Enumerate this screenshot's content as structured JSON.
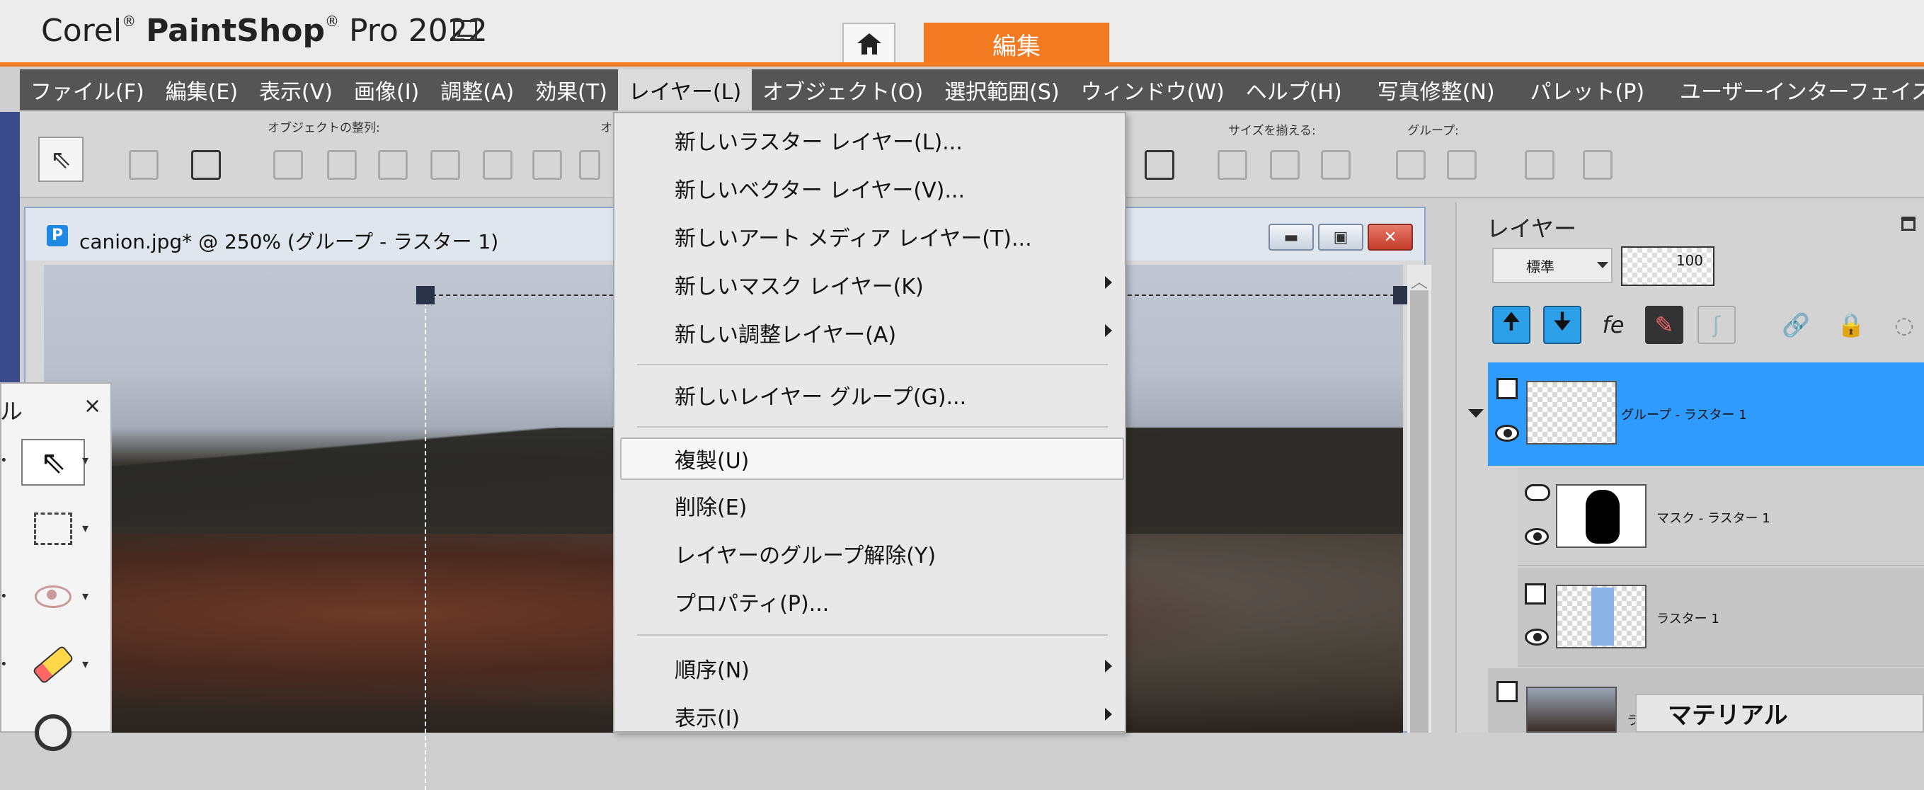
{
  "app": {
    "brand": "Corel",
    "product": "PaintShop",
    "pro": "Pro 2022",
    "home_tab": "home",
    "active_tab": "編集"
  },
  "menubar": {
    "items": [
      "ファイル(F)",
      "編集(E)",
      "表示(V)",
      "画像(I)",
      "調整(A)",
      "効果(T)",
      "レイヤー(L)",
      "オブジェクト(O)",
      "選択範囲(S)",
      "ウィンドウ(W)",
      "ヘルプ(H)",
      "写真修整(N)",
      "パレット(P)",
      "ユーザーインターフェイス(U)"
    ],
    "active": "レイヤー(L)"
  },
  "toolbar": {
    "align_label": "オブジェクトの整列:",
    "align_label_cut": "オ",
    "size_label": "サイズを揃える:",
    "group_label": "グループ:"
  },
  "document": {
    "title": "canion.jpg* @ 250% (グループ - ラスター 1)",
    "icon_letter": "P"
  },
  "tools_panel": {
    "title": "ル",
    "close": "×"
  },
  "context_menu": {
    "items": [
      {
        "label": "新しいラスター レイヤー(L)...",
        "submenu": false
      },
      {
        "label": "新しいベクター レイヤー(V)...",
        "submenu": false
      },
      {
        "label": "新しいアート メディア レイヤー(T)...",
        "submenu": false
      },
      {
        "label": "新しいマスク レイヤー(K)",
        "submenu": true
      },
      {
        "label": "新しい調整レイヤー(A)",
        "submenu": true
      },
      {
        "label": "新しいレイヤー グループ(G)...",
        "submenu": false
      },
      {
        "label": "複製(U)",
        "submenu": false,
        "highlighted": true
      },
      {
        "label": "削除(E)",
        "submenu": false
      },
      {
        "label": "レイヤーのグループ解除(Y)",
        "submenu": false
      },
      {
        "label": "プロパティ(P)...",
        "submenu": false
      },
      {
        "label": "順序(N)",
        "submenu": true
      },
      {
        "label": "表示(I)",
        "submenu": true
      }
    ]
  },
  "layers": {
    "title": "レイヤー",
    "blend_mode": "標準",
    "opacity": "100",
    "rows": [
      {
        "name": "グループ - ラスター 1",
        "selected": true
      },
      {
        "name": "マスク - ラスター 1"
      },
      {
        "name": "ラスター 1"
      },
      {
        "name": "ラ"
      }
    ]
  },
  "materials": {
    "title": "マテリアル"
  },
  "colors": {
    "accent": "#f47a22",
    "menubar_bg": "#555555",
    "layer_selected": "#2f9bff"
  }
}
